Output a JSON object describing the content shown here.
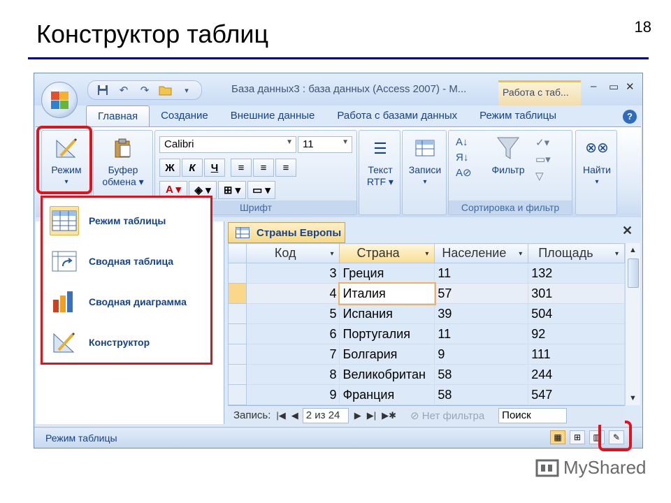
{
  "slide": {
    "title": "Конструктор таблиц",
    "number": "18"
  },
  "window": {
    "title": "База данных3 : база данных (Access 2007) - М...",
    "context_tab": "Работа с таб...",
    "controls": [
      "–",
      "▭",
      "✕"
    ]
  },
  "ribbon": {
    "tabs": [
      "Главная",
      "Создание",
      "Внешние данные",
      "Работа с базами данных",
      "Режим таблицы"
    ],
    "active_tab": "Главная",
    "mode_button": "Режим",
    "clipboard_button": [
      "Буфер",
      "обмена"
    ],
    "font": {
      "name": "Calibri",
      "size": "11",
      "group_label": "Шрифт",
      "bold": "Ж",
      "italic": "К",
      "underline": "Ч"
    },
    "rtf_button": [
      "Текст",
      "RTF"
    ],
    "records_button": "Записи",
    "filter_button": "Фильтр",
    "sort_group_label": "Сортировка и фильтр",
    "find_button": "Найти"
  },
  "mode_menu": {
    "items": [
      {
        "label": "Режим таблицы",
        "icon": "datasheet-icon",
        "selected": true
      },
      {
        "label": "Сводная таблица",
        "icon": "pivot-table-icon"
      },
      {
        "label": "Сводная диаграмма",
        "icon": "pivot-chart-icon"
      },
      {
        "label": "Конструктор",
        "icon": "design-icon"
      }
    ]
  },
  "document": {
    "tab_title": "Страны Европы",
    "columns": [
      "Код",
      "Страна",
      "Население",
      "Площадь"
    ],
    "rows": [
      [
        "3",
        "Греция",
        "11",
        "132"
      ],
      [
        "4",
        "Италия",
        "57",
        "301"
      ],
      [
        "5",
        "Испания",
        "39",
        "504"
      ],
      [
        "6",
        "Португалия",
        "11",
        "92"
      ],
      [
        "7",
        "Болгария",
        "9",
        "111"
      ],
      [
        "8",
        "Великобритан",
        "58",
        "244"
      ],
      [
        "9",
        "Франция",
        "58",
        "547"
      ]
    ],
    "current_row": 1
  },
  "nav": {
    "label": "Запись:",
    "position": "2 из 24",
    "filter": "Нет фильтра",
    "search": "Поиск"
  },
  "status": {
    "text": "Режим таблицы"
  },
  "watermark": {
    "text": "MyShared"
  }
}
